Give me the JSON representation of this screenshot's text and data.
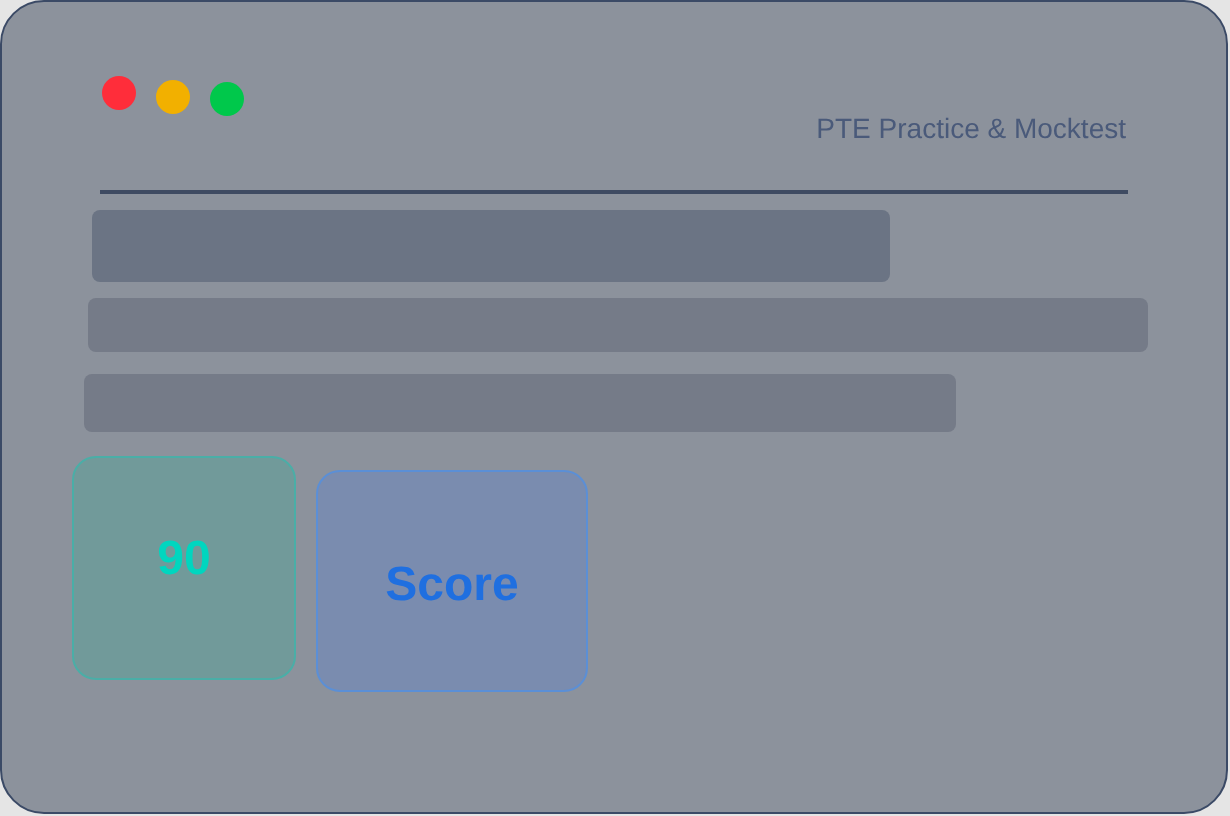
{
  "window": {
    "title": "PTE Practice & Mocktest"
  },
  "cards": [
    {
      "kind": "score",
      "text": "90"
    },
    {
      "kind": "label",
      "text": "Score"
    }
  ]
}
